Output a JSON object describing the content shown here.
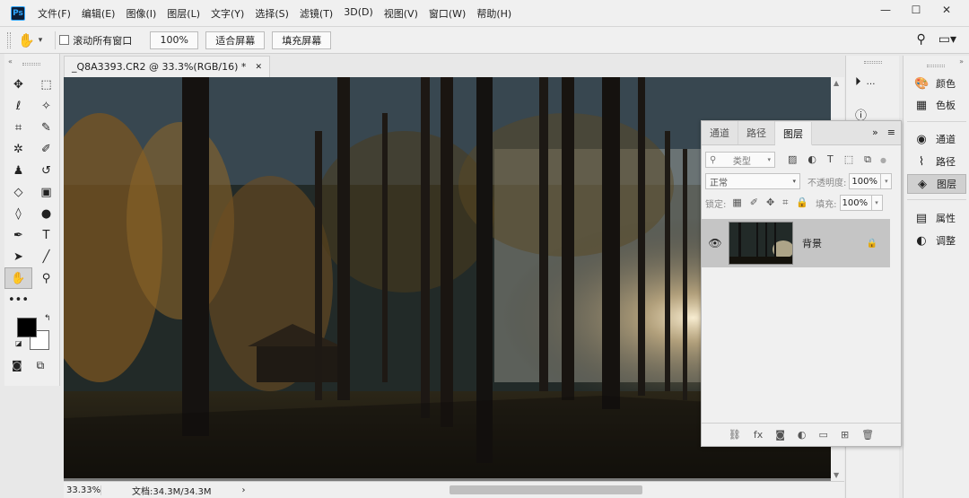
{
  "app": {
    "logo": "Ps"
  },
  "menu": [
    "文件(F)",
    "编辑(E)",
    "图像(I)",
    "图层(L)",
    "文字(Y)",
    "选择(S)",
    "滤镜(T)",
    "3D(D)",
    "视图(V)",
    "窗口(W)",
    "帮助(H)"
  ],
  "window_controls": {
    "minimize": "—",
    "maximize": "☐",
    "close": "✕"
  },
  "options": {
    "scroll_all_label": "滚动所有窗口",
    "zoom_value": "100%",
    "fit_screen": "适合屏幕",
    "fill_screen": "填充屏幕"
  },
  "document": {
    "tab_title": "_Q8A3393.CR2 @ 33.3%(RGB/16) *",
    "close": "✕",
    "zoom_status": "33.33%",
    "doc_info": "文档:34.3M/34.3M",
    "status_arrow": "›"
  },
  "tools": [
    {
      "name": "move-tool",
      "glyph": "✥"
    },
    {
      "name": "marquee-tool",
      "glyph": "⬚"
    },
    {
      "name": "lasso-tool",
      "glyph": "ℓ"
    },
    {
      "name": "magic-wand-tool",
      "glyph": "✧"
    },
    {
      "name": "crop-tool",
      "glyph": "⌗"
    },
    {
      "name": "eyedropper-tool",
      "glyph": "✎"
    },
    {
      "name": "healing-brush-tool",
      "glyph": "✲"
    },
    {
      "name": "brush-tool",
      "glyph": "✐"
    },
    {
      "name": "clone-stamp-tool",
      "glyph": "♟"
    },
    {
      "name": "history-brush-tool",
      "glyph": "↺"
    },
    {
      "name": "eraser-tool",
      "glyph": "◇"
    },
    {
      "name": "gradient-tool",
      "glyph": "▣"
    },
    {
      "name": "blur-tool",
      "glyph": "◊"
    },
    {
      "name": "dodge-tool",
      "glyph": "●"
    },
    {
      "name": "pen-tool",
      "glyph": "✒"
    },
    {
      "name": "type-tool",
      "glyph": "T"
    },
    {
      "name": "path-selection-tool",
      "glyph": "➤"
    },
    {
      "name": "line-tool",
      "glyph": "╱"
    },
    {
      "name": "hand-tool",
      "glyph": "✋"
    },
    {
      "name": "zoom-tool",
      "glyph": "⚲"
    },
    {
      "name": "more-tools",
      "glyph": "•••"
    }
  ],
  "mini_panel": [
    {
      "name": "history-icon",
      "glyph": "⏵",
      "label": "…"
    },
    {
      "name": "info-icon",
      "glyph": "ⓘ",
      "label": ""
    }
  ],
  "dock": [
    {
      "name": "color",
      "glyph": "🎨",
      "label": "颜色"
    },
    {
      "name": "swatches",
      "glyph": "▦",
      "label": "色板"
    },
    {
      "name": "channels",
      "glyph": "◉",
      "label": "通道"
    },
    {
      "name": "paths",
      "glyph": "⌇",
      "label": "路径"
    },
    {
      "name": "layers",
      "glyph": "◈",
      "label": "图层"
    },
    {
      "name": "properties",
      "glyph": "▤",
      "label": "属性"
    },
    {
      "name": "adjustments",
      "glyph": "◐",
      "label": "调整"
    }
  ],
  "layers_panel": {
    "tabs": [
      "通道",
      "路径",
      "图层"
    ],
    "active_tab": 2,
    "filter_kind": "类型",
    "blend_mode": "正常",
    "opacity_label": "不透明度:",
    "opacity_value": "100%",
    "lock_label": "锁定:",
    "fill_label": "填充:",
    "fill_value": "100%",
    "layer_name": "背景",
    "collapse": "»",
    "menu": "≡"
  }
}
